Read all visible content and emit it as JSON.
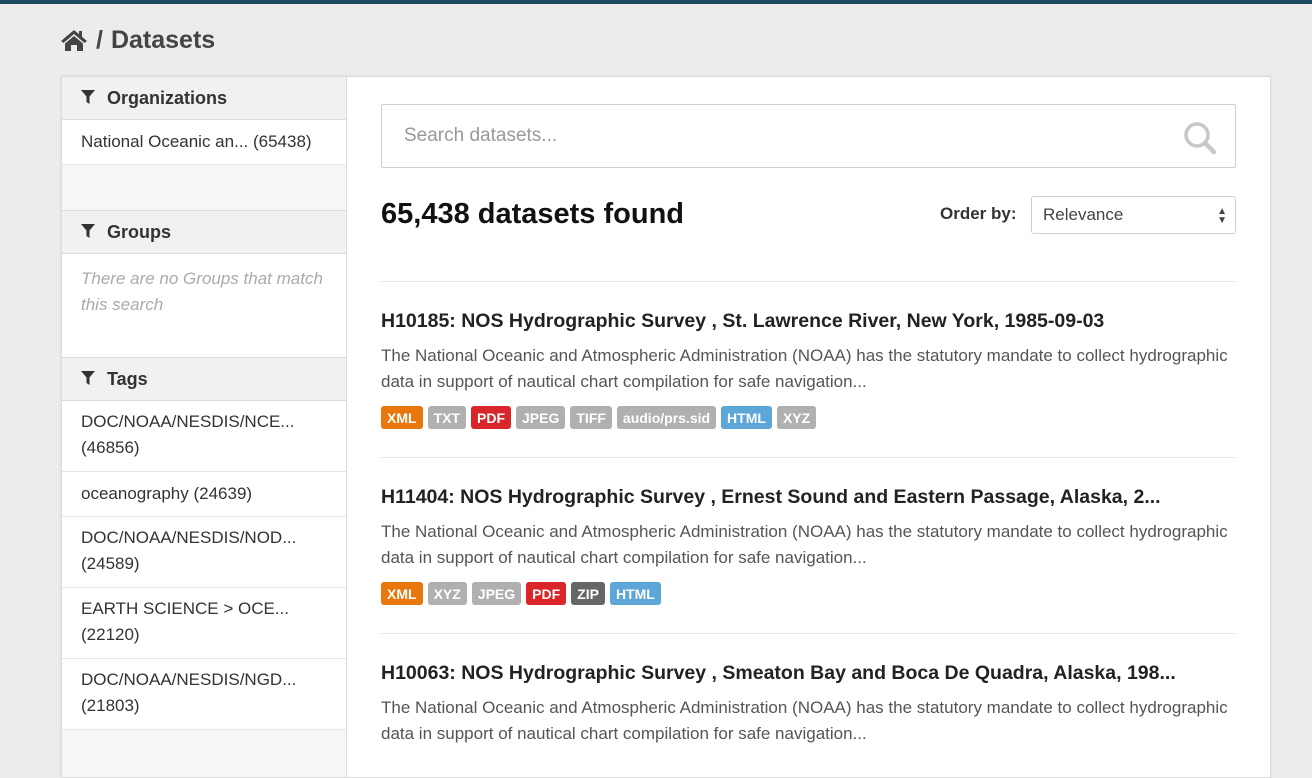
{
  "breadcrumb": {
    "separator": "/",
    "title": "Datasets"
  },
  "sidebar": {
    "organizations": {
      "heading": "Organizations",
      "items": [
        {
          "label": "National Oceanic an... (65438)"
        }
      ]
    },
    "groups": {
      "heading": "Groups",
      "empty_text": "There are no Groups that match this search"
    },
    "tags": {
      "heading": "Tags",
      "items": [
        {
          "line1": "DOC/NOAA/NESDIS/NCE...",
          "line2": "(46856)"
        },
        {
          "line1": "oceanography (24639)",
          "line2": ""
        },
        {
          "line1": "DOC/NOAA/NESDIS/NOD...",
          "line2": "(24589)"
        },
        {
          "line1": "EARTH SCIENCE > OCE...",
          "line2": "(22120)"
        },
        {
          "line1": "DOC/NOAA/NESDIS/NGD...",
          "line2": "(21803)"
        }
      ]
    }
  },
  "search": {
    "placeholder": "Search datasets...",
    "value": ""
  },
  "results_header": {
    "count_text": "65,438 datasets found",
    "order_label": "Order by:",
    "order_value": "Relevance"
  },
  "colors": {
    "xml": "#e8780d",
    "gray": "#b0b0b0",
    "pdf": "#d9262a",
    "html": "#5ca6d8",
    "zip": "#666666"
  },
  "results": [
    {
      "title": "H10185: NOS Hydrographic Survey , St. Lawrence River, New York, 1985-09-03",
      "description": "The National Oceanic and Atmospheric Administration (NOAA) has the statutory mandate to collect hydrographic data in support of nautical chart compilation for safe navigation...",
      "formats": [
        {
          "label": "XML",
          "color": "#e8780d"
        },
        {
          "label": "TXT",
          "color": "#b0b0b0"
        },
        {
          "label": "PDF",
          "color": "#d9262a"
        },
        {
          "label": "JPEG",
          "color": "#b0b0b0"
        },
        {
          "label": "TIFF",
          "color": "#b0b0b0"
        },
        {
          "label": "audio/prs.sid",
          "color": "#b0b0b0"
        },
        {
          "label": "HTML",
          "color": "#5ca6d8"
        },
        {
          "label": "XYZ",
          "color": "#b0b0b0"
        }
      ]
    },
    {
      "title": "H11404: NOS Hydrographic Survey , Ernest Sound and Eastern Passage, Alaska, 2...",
      "description": "The National Oceanic and Atmospheric Administration (NOAA) has the statutory mandate to collect hydrographic data in support of nautical chart compilation for safe navigation...",
      "formats": [
        {
          "label": "XML",
          "color": "#e8780d"
        },
        {
          "label": "XYZ",
          "color": "#b0b0b0"
        },
        {
          "label": "JPEG",
          "color": "#b0b0b0"
        },
        {
          "label": "PDF",
          "color": "#d9262a"
        },
        {
          "label": "ZIP",
          "color": "#666666"
        },
        {
          "label": "HTML",
          "color": "#5ca6d8"
        }
      ]
    },
    {
      "title": "H10063: NOS Hydrographic Survey , Smeaton Bay and Boca De Quadra, Alaska, 198...",
      "description": "The National Oceanic and Atmospheric Administration (NOAA) has the statutory mandate to collect hydrographic data in support of nautical chart compilation for safe navigation...",
      "formats": []
    }
  ]
}
